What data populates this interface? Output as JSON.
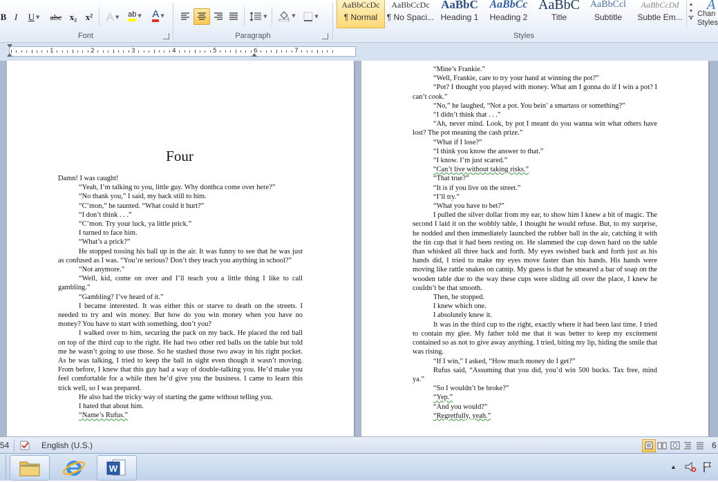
{
  "ribbon": {
    "font": {
      "label": "Font",
      "bold": "B",
      "underline": "U",
      "strike": "abc",
      "subscript": "x₂",
      "superscript": "x²",
      "text_effect": "A",
      "highlight": "ab",
      "font_color": "A"
    },
    "paragraph": {
      "label": "Paragraph"
    },
    "styles": {
      "label": "Styles",
      "items": [
        {
          "preview": "AaBbCcDc",
          "name": "¶ Normal"
        },
        {
          "preview": "AaBbCcDc",
          "name": "¶ No Spaci..."
        },
        {
          "preview": "AaBbC",
          "name": "Heading 1"
        },
        {
          "preview": "AaBbCc",
          "name": "Heading 2"
        },
        {
          "preview": "AaBbC",
          "name": "Title"
        },
        {
          "preview": "AaBbCcl",
          "name": "Subtitle"
        },
        {
          "preview": "AaBbCcDd",
          "name": "Subtle Em..."
        }
      ],
      "change_label_1": "Chan",
      "change_label_2": "Styles"
    },
    "colors": {
      "highlight": "#ffff00",
      "font_color": "#e0302a",
      "selected_style": "#ffd872"
    }
  },
  "ruler": {
    "numbers": [
      "1",
      "2",
      "3",
      "4",
      "5",
      "6",
      "7"
    ]
  },
  "document": {
    "chapter_title": "Four",
    "left_page": [
      {
        "t": "Damn! I was caught!",
        "ni": true
      },
      {
        "t": "“Yeah, I’m talking to you, little guy. Why donthca come over here?”"
      },
      {
        "t": "“No thank you,” I said, my back still to him."
      },
      {
        "t": "“C’mon,” he taunted. “What could it hurt?”"
      },
      {
        "t": "“I don’t think . . .”"
      },
      {
        "t": "“C’mon. Try your luck, ya little prick.”"
      },
      {
        "t": "I turned to face him."
      },
      {
        "t": "“What’s a prick?”"
      },
      {
        "t": "He stopped tossing his ball up in the air. It was funny to see that he was just as confused as I was. “You’re serious? Don’t they teach you anything in school?”"
      },
      {
        "t": "“Not anymore.”"
      },
      {
        "t": "“Well, kid, come on over and I’ll teach you a little thing I like to call gambling.”"
      },
      {
        "t": "“Gambling? I’ve heard of it.”"
      },
      {
        "t": "I became interested. It was either this or starve to death on the streets. I needed to try and win money. But how do you win money when you have no money? You have to start with something, don’t you?"
      },
      {
        "t": "I walked over to him, securing the pack on my back. He placed the red ball on top of the third cup to the right. He had two other red balls on the table but told me he wasn’t going to use those. So he stashed those two away in his right pocket. As he was talking, I tried to keep the ball in sight even though it wasn’t moving. From before, I knew that this guy had a way of double-talking you. He’d make you feel comfortable for a while then he’d give you the business. I came to learn this trick well, so I was prepared."
      },
      {
        "t": "He also had the tricky way of starting the game without telling you."
      },
      {
        "t": "I hated that about him."
      },
      {
        "t": "“Name’s Rufus.”",
        "sq": true
      }
    ],
    "right_page": [
      {
        "t": "“Mine’s Frankie.”"
      },
      {
        "t": "“Well, Frankie, care to try your hand at winning the pot?”"
      },
      {
        "t": "“Pot? I thought you played with money. What am I gonna do if I win a pot? I can’t cook.”"
      },
      {
        "t": "“No,” he laughed, “Not a pot. You bein’ a smartass or something?”"
      },
      {
        "t": "“I didn’t think that . . .”"
      },
      {
        "t": "“Ah, never mind. Look, by pot I meant do you wanna win what others have lost? The pot meaning the cash prize.”"
      },
      {
        "t": "“What if I lose?”"
      },
      {
        "t": "“I think you know the answer to that.”"
      },
      {
        "t": "“I know. I’m just scared.”"
      },
      {
        "t": "“Can’t live without taking risks.”",
        "sq": true
      },
      {
        "t": "“That true?”"
      },
      {
        "t": "“It is if you live on the street.”"
      },
      {
        "t": "“I’ll try.”"
      },
      {
        "t": "“What you have to bet?”"
      },
      {
        "t": "I pulled the silver dollar from my ear, to show him I knew a bit of magic. The second I laid it on the wobbly table, I thought he would refuse. But, to my surprise, he nodded and then immediately launched the rubber ball in the air, catching it with the tin cup that it had been resting on. He slammed the cup down hard on the table than whisked all three back and forth. My eyes swished back and forth just as his hands did, I tried to make my eyes move faster than his hands. His hands were moving like rattle snakes on catnip. My guess is that he smeared a bar of soap on the wooden table due to the way these cups were sliding all over the place, I knew he couldn’t be that smooth."
      },
      {
        "t": "Then, he stopped."
      },
      {
        "t": "I knew which one."
      },
      {
        "t": "I absolutely knew it."
      },
      {
        "t": "It was in the third cup to the right, exactly where it had been last time. I tried to contain my glee. My father told me that it was better to keep my excitement contained so as not to give away anything. I tried, biting my lip, hiding the smile that was rising."
      },
      {
        "t": "“If I win,” I asked, “How much money do I get?”"
      },
      {
        "t": "Rufus said, “Assuming that you did, you’d win 500 bucks. Tax free, mind ya.”"
      },
      {
        "t": "“So I wouldn’t be broke?”"
      },
      {
        "t": "“Yep.”",
        "sq": true
      },
      {
        "t": "“And you would?”"
      },
      {
        "t": "“Regretfully, yeah.”",
        "sq": true
      }
    ]
  },
  "statusbar": {
    "page_count_fragment": "54",
    "language": "English (U.S.)",
    "zoom_fragment": "6"
  }
}
